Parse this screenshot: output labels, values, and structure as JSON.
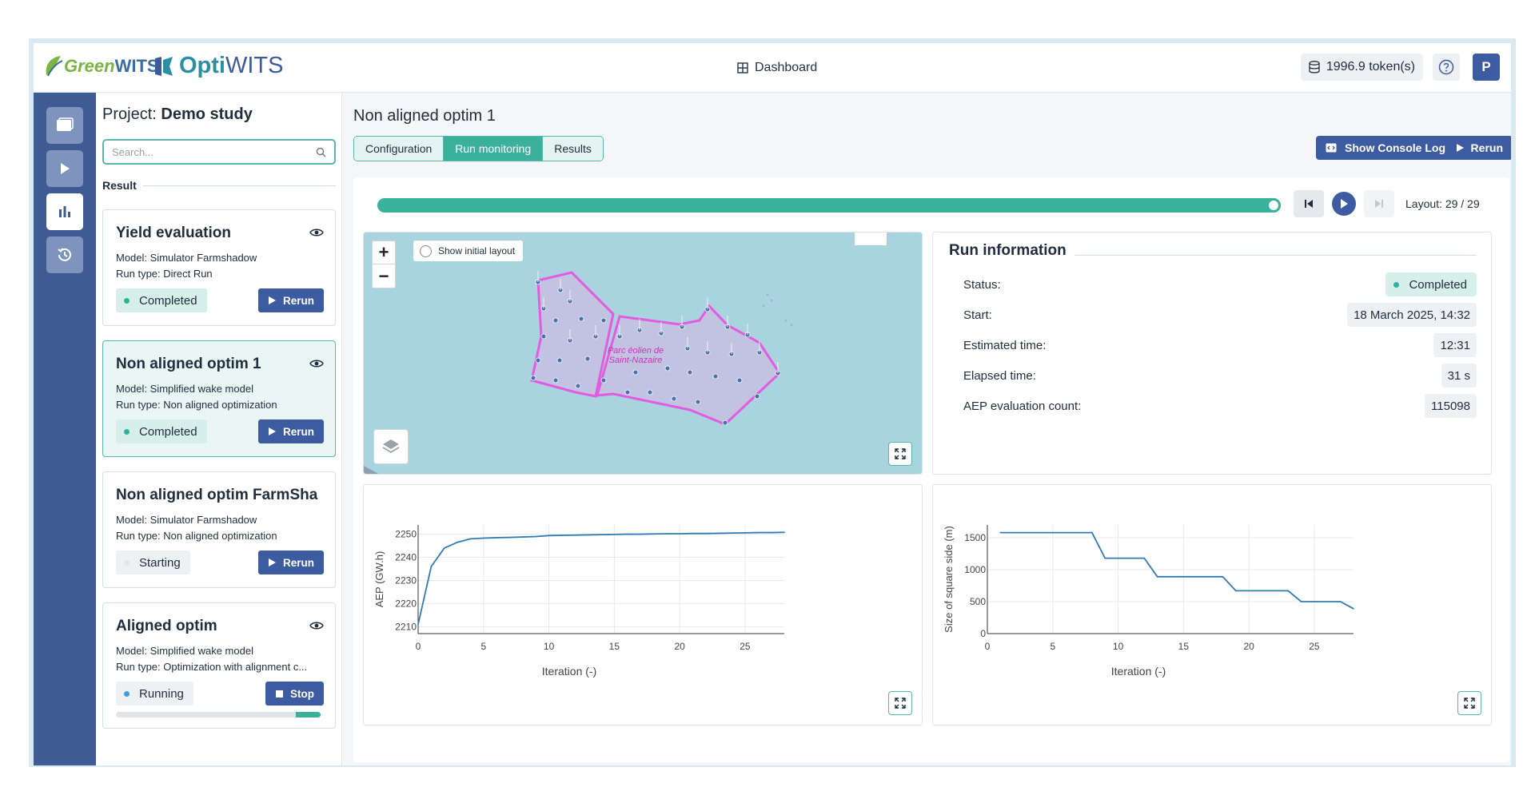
{
  "header": {
    "logo_green_part1": "Green",
    "logo_green_part2": "WITS",
    "logo_opti_part1": "Opti",
    "logo_opti_part2": "WITS",
    "dashboard_label": "Dashboard",
    "tokens_label": "1996.9 token(s)",
    "user_initial": "P"
  },
  "rail": {
    "icons": [
      "folder-icon",
      "play-icon",
      "bar-chart-icon",
      "history-icon"
    ],
    "active_index": 2
  },
  "left_panel": {
    "project_prefix": "Project:",
    "project_name": "Demo study",
    "search_placeholder": "Search...",
    "result_header": "Result",
    "cards": [
      {
        "title": "Yield evaluation",
        "model": "Model: Simulator Farmshadow",
        "run_type": "Run type: Direct Run",
        "status": "Completed",
        "action": "Rerun",
        "selected": false
      },
      {
        "title": "Non aligned optim 1",
        "model": "Model: Simplified wake model",
        "run_type": "Run type: Non aligned optimization",
        "status": "Completed",
        "action": "Rerun",
        "selected": true
      },
      {
        "title": "Non aligned optim FarmSha",
        "model": "Model: Simulator Farmshadow",
        "run_type": "Run type: Non aligned optimization",
        "status": "Starting",
        "action": "Rerun",
        "selected": false
      },
      {
        "title": "Aligned optim",
        "model": "Model: Simplified wake model",
        "run_type": "Run type: Optimization with alignment c...",
        "status": "Running",
        "action": "Stop",
        "selected": false,
        "progress": 0.12
      }
    ]
  },
  "main": {
    "run_title": "Non aligned optim 1",
    "tabs": [
      "Configuration",
      "Run monitoring",
      "Results"
    ],
    "active_tab": 1,
    "console_button": "Show Console Log",
    "rerun_button": "Rerun",
    "layout_progress": 1.0,
    "layout_label": "Layout: 29 / 29",
    "map": {
      "show_initial_label": "Show initial layout",
      "zoom_in": "+",
      "zoom_out": "−",
      "place_label": "Parc éolien de Saint-Nazaire"
    },
    "run_info": {
      "title": "Run information",
      "rows": [
        {
          "label": "Status:",
          "value": "Completed"
        },
        {
          "label": "Start:",
          "value": "18 March 2025, 14:32"
        },
        {
          "label": "Estimated time:",
          "value": "12:31"
        },
        {
          "label": "Elapsed time:",
          "value": "31 s"
        },
        {
          "label": "AEP evaluation count:",
          "value": "115098"
        }
      ]
    }
  },
  "colors": {
    "accent_teal": "#3bb19c",
    "brand_blue": "#3c5ba0",
    "rail_blue": "#3f5b93",
    "line_blue": "#2f7bb5",
    "farm_outline": "#e15ce0"
  },
  "chart_data": [
    {
      "type": "line",
      "xlabel": "Iteration (-)",
      "ylabel": "AEP (GW.h)",
      "xlim": [
        0,
        28
      ],
      "ylim": [
        2207,
        2254
      ],
      "xticks": [
        0,
        5,
        10,
        15,
        20,
        25
      ],
      "yticks": [
        2210,
        2220,
        2230,
        2240,
        2250
      ],
      "grid": true,
      "series": [
        {
          "x": [
            0,
            1,
            2,
            3,
            4,
            5,
            6,
            7,
            8,
            9,
            10,
            11,
            12,
            13,
            14,
            15,
            16,
            17,
            18,
            19,
            20,
            21,
            22,
            23,
            24,
            25,
            26,
            27,
            28
          ],
          "values": [
            2211,
            2236,
            2244,
            2246.5,
            2248,
            2248.3,
            2248.5,
            2248.6,
            2248.8,
            2249,
            2249.4,
            2249.5,
            2249.6,
            2249.7,
            2249.8,
            2249.9,
            2250,
            2250,
            2250.1,
            2250.2,
            2250.2,
            2250.3,
            2250.3,
            2250.4,
            2250.5,
            2250.6,
            2250.7,
            2250.7,
            2250.8
          ]
        }
      ]
    },
    {
      "type": "line",
      "xlabel": "Iteration (-)",
      "ylabel": "Size of square side (m)",
      "xlim": [
        0,
        28
      ],
      "ylim": [
        0,
        1700
      ],
      "xticks": [
        0,
        5,
        10,
        15,
        20,
        25
      ],
      "yticks": [
        0,
        500,
        1000,
        1500
      ],
      "grid": true,
      "series": [
        {
          "x": [
            1,
            8,
            9,
            12,
            13,
            18,
            19,
            23,
            24,
            27,
            28
          ],
          "values": [
            1580,
            1580,
            1180,
            1180,
            890,
            890,
            670,
            670,
            500,
            500,
            390
          ]
        }
      ]
    }
  ]
}
